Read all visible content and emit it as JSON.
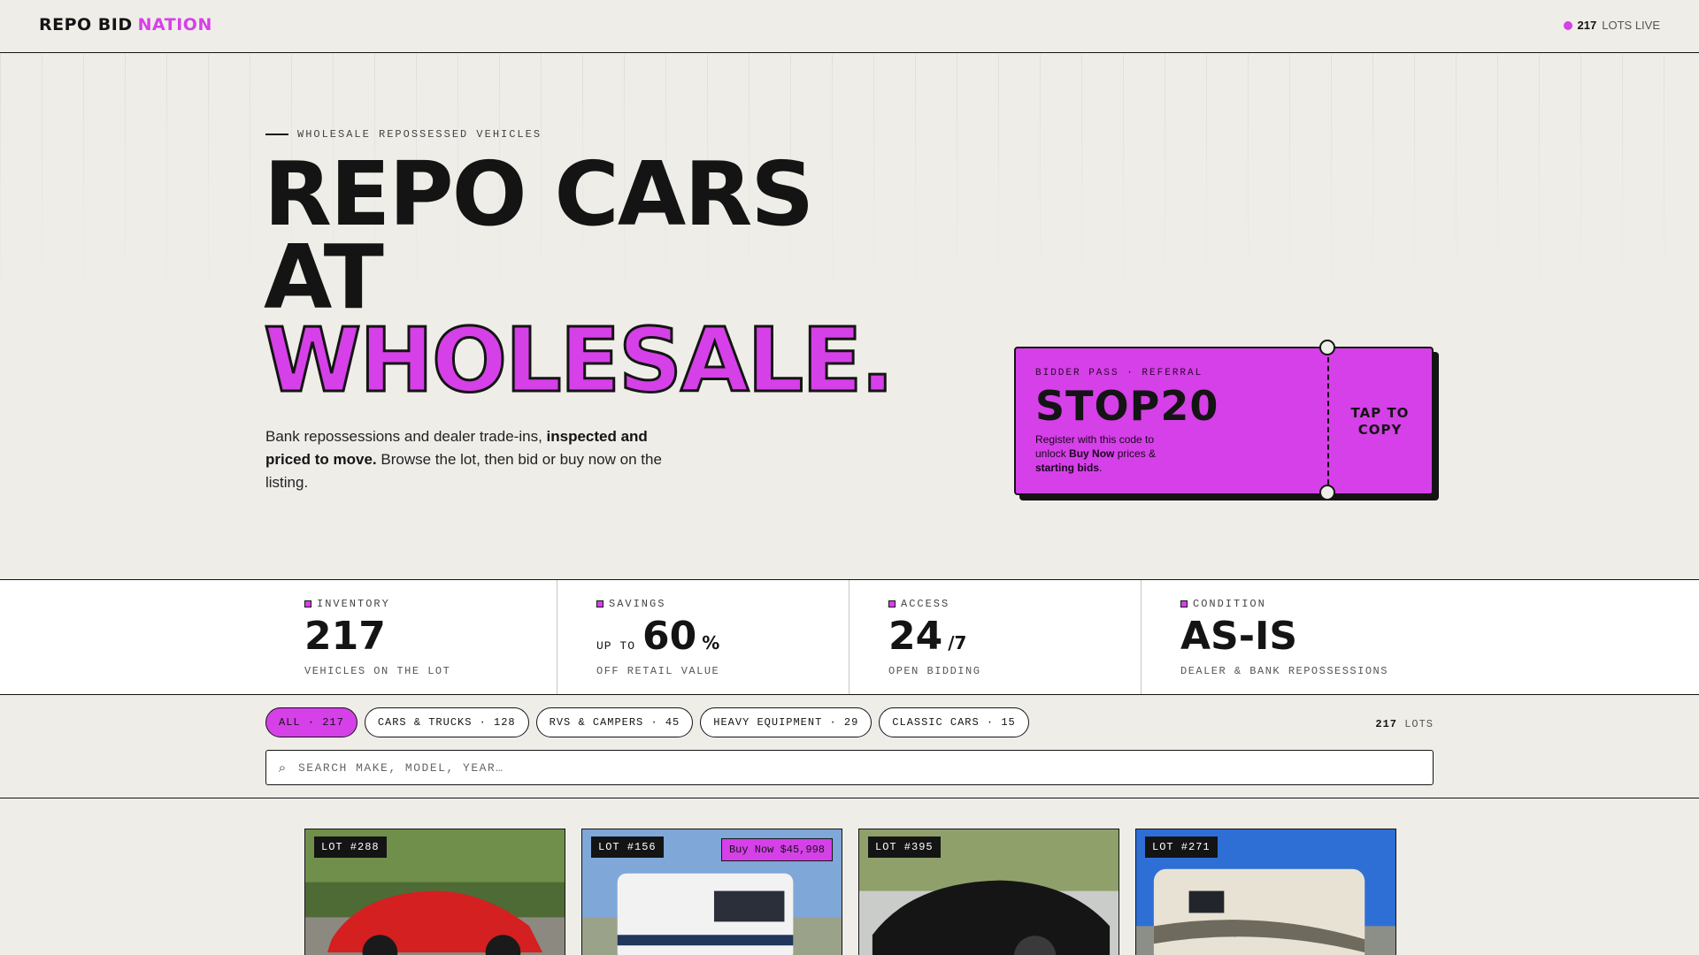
{
  "header": {
    "logo_main": "REPO BID",
    "logo_accent": "NATION",
    "live_count": "217",
    "live_label": "LOTS LIVE"
  },
  "hero": {
    "eyebrow": "WHOLESALE REPOSSESSED VEHICLES",
    "headline_1": "REPO CARS",
    "headline_2": "AT",
    "headline_3": "WHOLESALE.",
    "lede_1": "Bank repossessions and dealer trade-ins, ",
    "lede_bold": "inspected and priced to move.",
    "lede_2": " Browse the lot, then bid or buy now on the listing."
  },
  "pass": {
    "kicker": "BIDDER PASS · REFERRAL",
    "code": "STOP20",
    "desc_1": "Register with this code to unlock ",
    "desc_bold_1": "Buy Now",
    "desc_2": " prices & ",
    "desc_bold_2": "starting bids",
    "desc_3": ".",
    "cta": "TAP TO COPY"
  },
  "stats": [
    {
      "label": "INVENTORY",
      "pre": "",
      "value": "217",
      "suffix": "",
      "sub": "VEHICLES ON THE LOT"
    },
    {
      "label": "SAVINGS",
      "pre": "UP TO",
      "value": "60",
      "suffix": "%",
      "sub": "OFF RETAIL VALUE"
    },
    {
      "label": "ACCESS",
      "pre": "",
      "value": "24",
      "suffix": "/7",
      "sub": "OPEN BIDDING"
    },
    {
      "label": "CONDITION",
      "pre": "",
      "value": "AS-IS",
      "suffix": "",
      "sub": "DEALER & BANK REPOSSESSIONS"
    }
  ],
  "filters": {
    "chips": [
      "ALL · 217",
      "CARS & TRUCKS · 128",
      "RVS & CAMPERS · 45",
      "HEAVY EQUIPMENT · 29",
      "CLASSIC CARS · 15"
    ],
    "lots_count": "217",
    "lots_label": "LOTS",
    "search_placeholder": "SEARCH MAKE, MODEL, YEAR…"
  },
  "cards": [
    {
      "lot": "LOT #288",
      "buy_now": ""
    },
    {
      "lot": "LOT #156",
      "buy_now": "Buy Now $45,998"
    },
    {
      "lot": "LOT #395",
      "buy_now": ""
    },
    {
      "lot": "LOT #271",
      "buy_now": ""
    }
  ],
  "colors": {
    "accent": "#d640e8",
    "ink": "#141414",
    "paper": "#efede8"
  }
}
